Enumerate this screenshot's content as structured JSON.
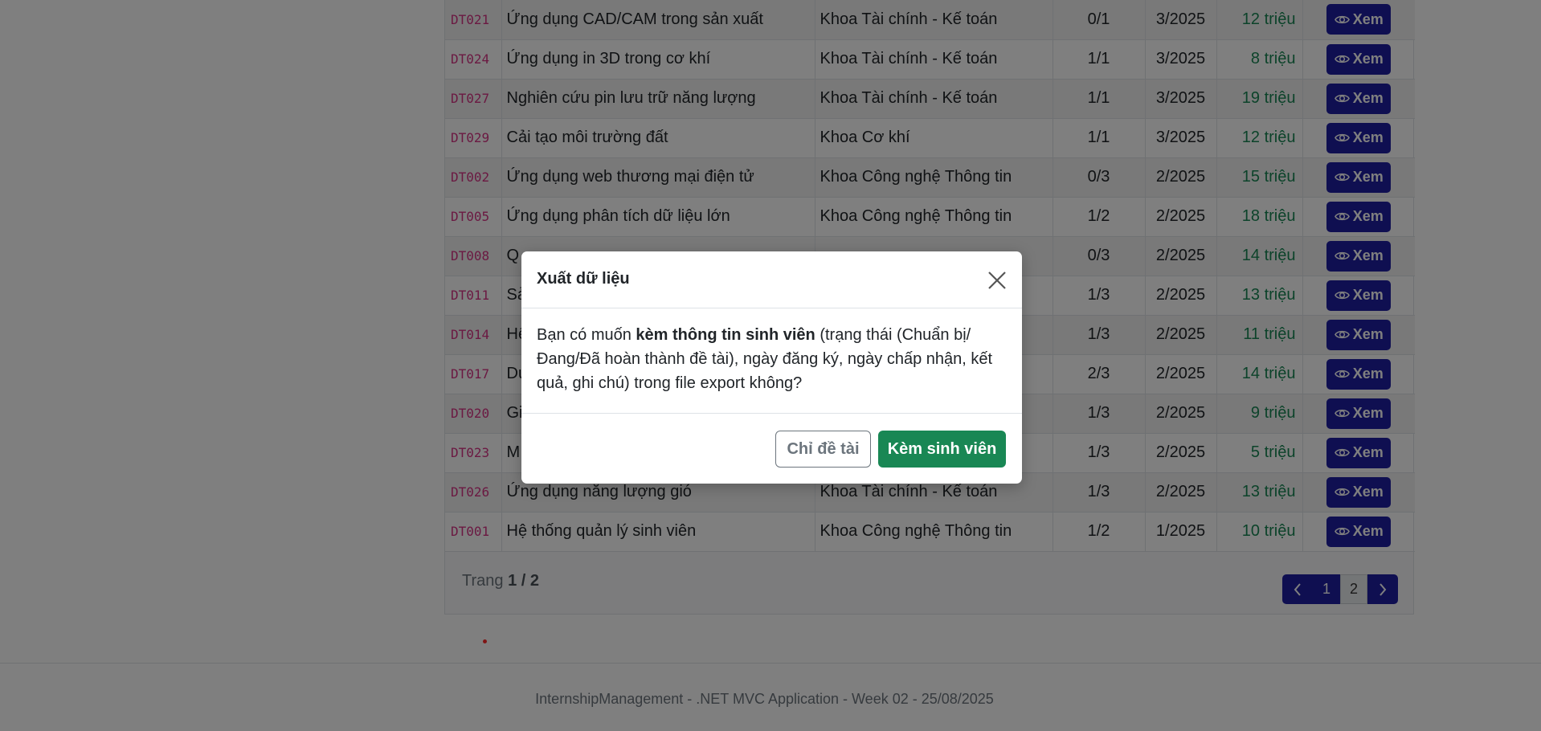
{
  "table": {
    "rows": [
      {
        "code": "DT021",
        "name": "Ứng dụng CAD/CAM trong sản xuất",
        "dept": "Khoa Tài chính - Kế toán",
        "members": "0/1",
        "semester": "3/2025",
        "funding": "12 triệu",
        "action": "Xem"
      },
      {
        "code": "DT024",
        "name": "Ứng dụng in 3D trong cơ khí",
        "dept": "Khoa Tài chính - Kế toán",
        "members": "1/1",
        "semester": "3/2025",
        "funding": "8 triệu",
        "action": "Xem"
      },
      {
        "code": "DT027",
        "name": "Nghiên cứu pin lưu trữ năng lượng",
        "dept": "Khoa Tài chính - Kế toán",
        "members": "1/1",
        "semester": "3/2025",
        "funding": "19 triệu",
        "action": "Xem"
      },
      {
        "code": "DT029",
        "name": "Cải tạo môi trường đất",
        "dept": "Khoa Cơ khí",
        "members": "1/1",
        "semester": "3/2025",
        "funding": "12 triệu",
        "action": "Xem"
      },
      {
        "code": "DT002",
        "name": "Ứng dụng web thương mại điện tử",
        "dept": "Khoa Công nghệ Thông tin",
        "members": "0/3",
        "semester": "2/2025",
        "funding": "15 triệu",
        "action": "Xem"
      },
      {
        "code": "DT005",
        "name": "Ứng dụng phân tích dữ liệu lớn",
        "dept": "Khoa Công nghệ Thông tin",
        "members": "1/2",
        "semester": "2/2025",
        "funding": "18 triệu",
        "action": "Xem"
      },
      {
        "code": "DT008",
        "name": "Q",
        "dept": "",
        "members": "0/3",
        "semester": "2/2025",
        "funding": "14 triệu",
        "action": "Xem"
      },
      {
        "code": "DT011",
        "name": "Sả",
        "dept": "",
        "members": "1/3",
        "semester": "2/2025",
        "funding": "13 triệu",
        "action": "Xem"
      },
      {
        "code": "DT014",
        "name": "Hệ",
        "dept": "",
        "members": "1/3",
        "semester": "2/2025",
        "funding": "11 triệu",
        "action": "Xem"
      },
      {
        "code": "DT017",
        "name": "Du",
        "dept": "",
        "members": "2/3",
        "semester": "2/2025",
        "funding": "14 triệu",
        "action": "Xem"
      },
      {
        "code": "DT020",
        "name": "Gi",
        "dept": "",
        "members": "1/3",
        "semester": "2/2025",
        "funding": "9 triệu",
        "action": "Xem"
      },
      {
        "code": "DT023",
        "name": "M",
        "dept": "",
        "members": "1/3",
        "semester": "2/2025",
        "funding": "5 triệu",
        "action": "Xem"
      },
      {
        "code": "DT026",
        "name": "Ứng dụng năng lượng gió",
        "dept": "Khoa Tài chính - Kế toán",
        "members": "1/3",
        "semester": "2/2025",
        "funding": "13 triệu",
        "action": "Xem"
      },
      {
        "code": "DT001",
        "name": "Hệ thống quản lý sinh viên",
        "dept": "Khoa Công nghệ Thông tin",
        "members": "1/2",
        "semester": "1/2025",
        "funding": "10 triệu",
        "action": "Xem"
      }
    ]
  },
  "pagination": {
    "prefix": "Trang",
    "current": "1",
    "separator": "/",
    "total": "2",
    "pages": [
      "1",
      "2"
    ],
    "prev_icon": "chevron-left-icon",
    "next_icon": "chevron-right-icon"
  },
  "footer": {
    "text": "InternshipManagement - .NET MVC Application - Week 02 - 25/08/2025"
  },
  "modal": {
    "title": "Xuất dữ liệu",
    "body_prefix": "Bạn có muốn ",
    "body_bold": "kèm thông tin sinh viên",
    "body_suffix": " (trạng thái (Chuẩn bị/Đang/Đã hoàn thành đề tài), ngày đăng ký, ngày chấp nhận, kết quả, ghi chú) trong file export không?",
    "cancel_label": "Chỉ đề tài",
    "confirm_label": "Kèm sinh viên"
  },
  "colors": {
    "primary": "#1f1fa3",
    "success": "#198754",
    "code": "#d63384"
  }
}
